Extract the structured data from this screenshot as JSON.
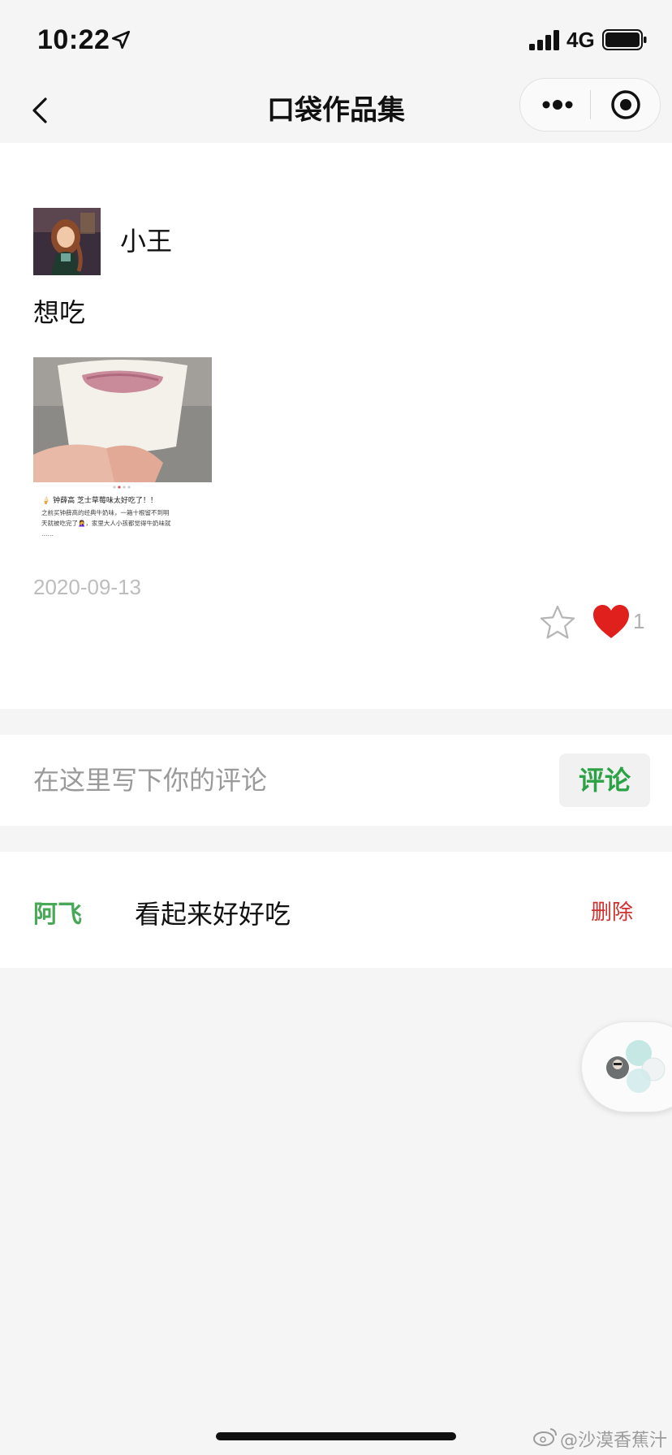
{
  "status_bar": {
    "time": "10:22",
    "network": "4G",
    "icons": [
      "location-arrow-icon",
      "signal-bars-icon",
      "battery-icon"
    ]
  },
  "nav": {
    "title": "口袋作品集",
    "icons": [
      "back-chevron-icon",
      "more-dots-icon",
      "target-icon"
    ]
  },
  "post": {
    "username": "小王",
    "content": "想吃",
    "image": {
      "caption_line1": "钟薛高 芝士草莓味太好吃了！！",
      "caption_line2": "之前买钟薛高的经典牛奶味，一箱十根留不到明",
      "caption_line3": "天就被吃完了🤦‍♀️，家里大人小孩都觉得牛奶味就"
    },
    "date": "2020-09-13",
    "like_count": "1"
  },
  "comment_box": {
    "placeholder": "在这里写下你的评论",
    "button_label": "评论"
  },
  "comments": [
    {
      "user": "阿飞",
      "text": "看起来好好吃",
      "action": "删除"
    }
  ],
  "watermark": "@沙漠香蕉汁",
  "colors": {
    "accent_green": "#2ba245",
    "delete_red": "#d0312d",
    "heart_red": "#e0201c"
  }
}
